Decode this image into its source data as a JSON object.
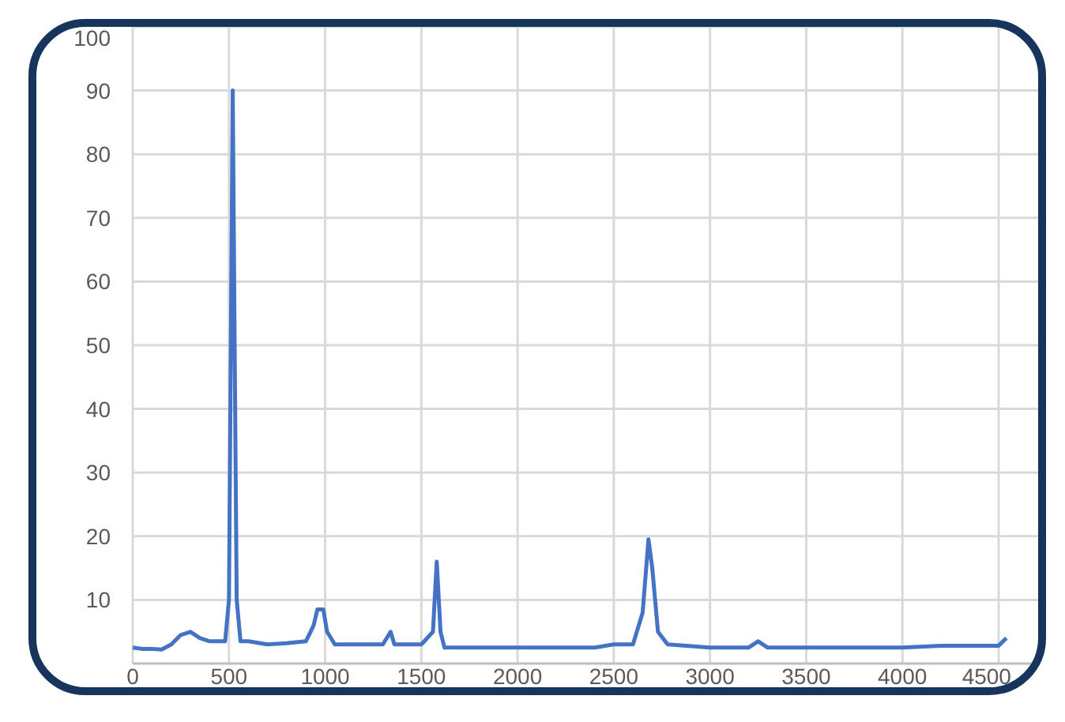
{
  "chart_data": {
    "type": "line",
    "xlim": [
      0,
      4730
    ],
    "ylim": [
      0,
      100
    ],
    "xticks": [
      0,
      500,
      1000,
      1500,
      2000,
      2500,
      3000,
      3500,
      4000,
      4500
    ],
    "grid": true,
    "yticks": [
      10,
      20,
      30,
      40,
      50,
      60,
      70,
      80,
      90,
      100
    ],
    "x": [
      0,
      50,
      100,
      150,
      200,
      250,
      300,
      350,
      400,
      480,
      500,
      510,
      520,
      530,
      540,
      560,
      600,
      700,
      800,
      900,
      940,
      960,
      990,
      1010,
      1050,
      1200,
      1300,
      1340,
      1360,
      1500,
      1560,
      1580,
      1600,
      1620,
      1700,
      2000,
      2400,
      2500,
      2600,
      2650,
      2680,
      2700,
      2730,
      2780,
      3000,
      3200,
      3250,
      3300,
      3500,
      4000,
      4200,
      4500,
      4540
    ],
    "series": [
      {
        "color": "#4472c4",
        "values": [
          2.5,
          2.3,
          2.3,
          2.2,
          3,
          4.5,
          5,
          4,
          3.5,
          3.5,
          10,
          50,
          90,
          50,
          10,
          3.5,
          3.5,
          3,
          3.2,
          3.5,
          6,
          8.5,
          8.5,
          5,
          3,
          3,
          3,
          5,
          3,
          3,
          5,
          16,
          5,
          2.5,
          2.5,
          2.5,
          2.5,
          3,
          3,
          8,
          19.5,
          15,
          5,
          3,
          2.5,
          2.5,
          3.5,
          2.5,
          2.5,
          2.5,
          2.8,
          2.8,
          4
        ]
      }
    ]
  }
}
